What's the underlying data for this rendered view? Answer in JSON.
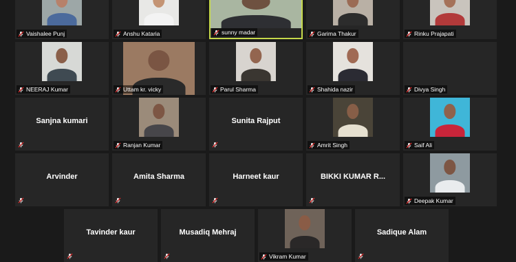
{
  "meeting": {
    "participants": [
      {
        "name": "Vaishalee Punj",
        "caption": true,
        "video": "person",
        "bg": "#9da7a7",
        "skin": "#b7816a",
        "shirt": "#4b6a9c"
      },
      {
        "name": "Anshu Kataria",
        "caption": true,
        "video": "person",
        "bg": "#e8e8e6",
        "skin": "#c49474",
        "shirt": "#f3f3f3"
      },
      {
        "name": "sunny madar",
        "caption": true,
        "video": "person",
        "bg": "#a9b6a1",
        "skin": "#6e5140",
        "shirt": "#2e2f33",
        "active": true
      },
      {
        "name": "Garima Thakur",
        "caption": true,
        "video": "person",
        "bg": "#b9b0a5",
        "skin": "#9b6b55",
        "shirt": "#2c2c2c"
      },
      {
        "name": "Rinku Prajapati",
        "caption": true,
        "video": "person",
        "bg": "#c9c4bd",
        "skin": "#a57259",
        "shirt": "#b23a3a"
      },
      {
        "name": "NEERAJ Kumar",
        "caption": true,
        "video": "person",
        "bg": "#d7d9d6",
        "skin": "#8a5f49",
        "shirt": "#3f4a52"
      },
      {
        "name": "Uttam kr. vicky",
        "caption": true,
        "video": "person",
        "bg": "#9b7a62",
        "skin": "#7a5543",
        "shirt": "#2a2a2a"
      },
      {
        "name": "Parul Sharma",
        "caption": true,
        "video": "person",
        "bg": "#d8d4cf",
        "skin": "#93654f",
        "shirt": "#3a3631"
      },
      {
        "name": "Shahida nazir",
        "caption": true,
        "video": "person",
        "bg": "#e5e2dd",
        "skin": "#a06a54",
        "shirt": "#2b2b33"
      },
      {
        "name": "Divya Singh",
        "caption": true,
        "video": "none"
      },
      {
        "name": "Sanjna kumari",
        "caption": false,
        "video": "none"
      },
      {
        "name": "Ranjan Kumar",
        "caption": true,
        "video": "person",
        "bg": "#9b8b7a",
        "skin": "#7d5644",
        "shirt": "#47464a"
      },
      {
        "name": "Sunita Rajput",
        "caption": false,
        "video": "none"
      },
      {
        "name": "Amrit Singh",
        "caption": true,
        "video": "person",
        "bg": "#4a4438",
        "skin": "#875e47",
        "shirt": "#e6e0d0"
      },
      {
        "name": "Saif Ali",
        "caption": true,
        "video": "person",
        "bg": "#3fb6d8",
        "skin": "#8f624c",
        "shirt": "#c8253a"
      },
      {
        "name": "Arvinder",
        "caption": false,
        "video": "none"
      },
      {
        "name": "Amita Sharma",
        "caption": false,
        "video": "none"
      },
      {
        "name": "Harneet kaur",
        "caption": false,
        "video": "none"
      },
      {
        "name": "BIKKI KUMAR R...",
        "caption": false,
        "video": "none"
      },
      {
        "name": "Deepak Kumar",
        "caption": true,
        "video": "person",
        "bg": "#8e9aa0",
        "skin": "#7d5644",
        "shirt": "#e9ecee"
      },
      {
        "name": "Tavinder kaur",
        "caption": false,
        "video": "none"
      },
      {
        "name": "Musadiq Mehraj",
        "caption": false,
        "video": "none"
      },
      {
        "name": "Vikram Kumar",
        "caption": true,
        "video": "person",
        "bg": "#6f6359",
        "skin": "#8a5c46",
        "shirt": "#2a2828"
      },
      {
        "name": "Sadique Alam",
        "caption": false,
        "video": "none"
      }
    ]
  },
  "colors": {
    "tile_bg": "#262626",
    "page_bg": "#1a1a1a",
    "active_border": "#c6d94a",
    "muted_mic": "#e02b2b"
  }
}
